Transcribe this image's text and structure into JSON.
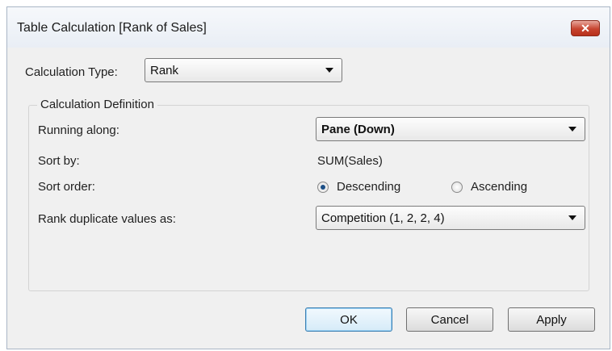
{
  "dialog": {
    "title": "Table Calculation [Rank of Sales]",
    "close_symbol": "✕"
  },
  "calculation_type": {
    "label": "Calculation Type:",
    "value": "Rank"
  },
  "definition": {
    "legend": "Calculation Definition",
    "running_along": {
      "label": "Running along:",
      "value": "Pane (Down)"
    },
    "sort_by": {
      "label": "Sort by:",
      "value": "SUM(Sales)"
    },
    "sort_order": {
      "label": "Sort order:",
      "options": [
        "Descending",
        "Ascending"
      ],
      "selected": "Descending"
    },
    "rank_duplicates": {
      "label": "Rank duplicate values as:",
      "value": "Competition (1, 2, 2, 4)"
    }
  },
  "buttons": {
    "ok": "OK",
    "cancel": "Cancel",
    "apply": "Apply"
  },
  "colors": {
    "close_button": "#c7442f",
    "default_button_border": "#3c7fb1",
    "dialog_background": "#f0f0f0"
  },
  "icons": {
    "close": "close-icon",
    "dropdown": "chevron-down-icon"
  }
}
